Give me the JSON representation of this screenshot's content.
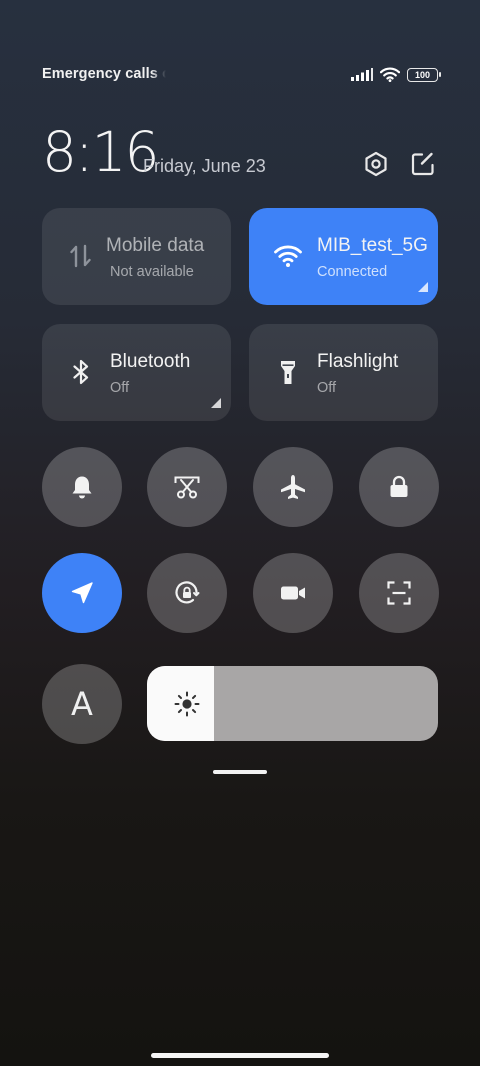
{
  "status_bar": {
    "carrier_text": "Emergency calls only",
    "battery_level": "100",
    "icons": [
      "signal-icon",
      "wifi-icon",
      "battery-icon"
    ]
  },
  "header": {
    "time": "8:16",
    "date": "Friday, June 23",
    "icons": [
      "settings-icon",
      "edit-icon"
    ]
  },
  "tiles": {
    "mobile_data": {
      "title": "Mobile data",
      "status": "Not available",
      "icon": "mobile-data-icon",
      "active": false
    },
    "wifi": {
      "title": "MIB_test_5G",
      "status": "Connected",
      "icon": "wifi-icon",
      "active": true
    },
    "bluetooth": {
      "title": "Bluetooth",
      "status": "Off",
      "icon": "bluetooth-icon",
      "active": false
    },
    "flashlight": {
      "title": "Flashlight",
      "status": "Off",
      "icon": "flashlight-icon",
      "active": false
    }
  },
  "toggles": [
    {
      "name": "ring-mode",
      "icon": "bell-icon",
      "active": false
    },
    {
      "name": "screenshot",
      "icon": "scissors-icon",
      "active": false
    },
    {
      "name": "airplane-mode",
      "icon": "airplane-icon",
      "active": false
    },
    {
      "name": "lock-screen",
      "icon": "lock-icon",
      "active": false
    },
    {
      "name": "location",
      "icon": "location-arrow-icon",
      "active": true
    },
    {
      "name": "rotation-lock",
      "icon": "rotation-lock-icon",
      "active": false
    },
    {
      "name": "screen-recorder",
      "icon": "video-camera-icon",
      "active": false
    },
    {
      "name": "scanner",
      "icon": "scan-icon",
      "active": false
    }
  ],
  "font_button": {
    "label": "A",
    "icon": "font-size-icon"
  },
  "brightness": {
    "level": 0.23,
    "icon": "sun-icon"
  },
  "colors": {
    "accent": "#3e82f7",
    "tile_bg": "#373c47",
    "round_bg": "#5a5e66"
  }
}
